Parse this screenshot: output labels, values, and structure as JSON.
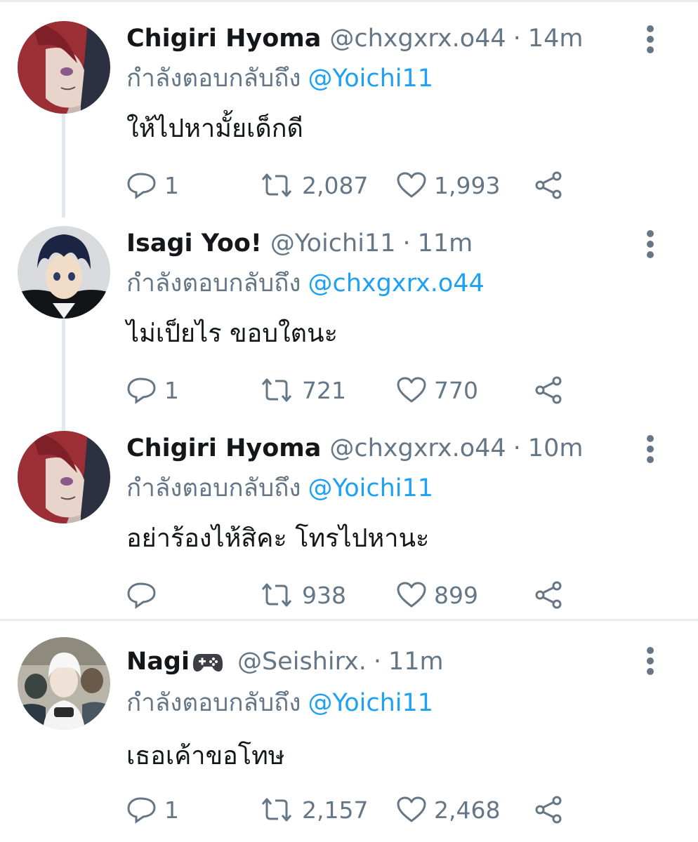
{
  "reply_prefix": "กำลังตอบกลับถึง",
  "colors": {
    "mention": "#1da1f2",
    "meta": "#657786",
    "text": "#14171a"
  },
  "tweets": [
    {
      "name": "Chigiri Hyoma",
      "handle": "@chxgxrx.o44",
      "separator": "·",
      "time": "14m",
      "replying_to": "@Yoichi11",
      "text": "ให้ไปหามั้ยเด็กดี",
      "replies": "1",
      "retweets": "2,087",
      "likes": "1,993",
      "avatar": "red-hair-avatar"
    },
    {
      "name": "Isagi Yoo!",
      "handle": "@Yoichi11",
      "separator": "·",
      "time": "11m",
      "replying_to": "@chxgxrx.o44",
      "text": "ไม่เป็ยไร ขอบใตนะ",
      "replies": "1",
      "retweets": "721",
      "likes": "770",
      "avatar": "dark-hair-avatar"
    },
    {
      "name": "Chigiri Hyoma",
      "handle": "@chxgxrx.o44",
      "separator": "·",
      "time": "10m",
      "replying_to": "@Yoichi11",
      "text": "อย่าร้องไห้สิคะ โทรไปหานะ",
      "replies": "",
      "retweets": "938",
      "likes": "899",
      "avatar": "red-hair-avatar"
    },
    {
      "name": "Nagi",
      "emoji": "game-controller-icon",
      "handle": "@Seishirx.",
      "separator": "·",
      "time": "11m",
      "replying_to": "@Yoichi11",
      "text": "เธอเค้าขอโทษ",
      "replies": "1",
      "retweets": "2,157",
      "likes": "2,468",
      "avatar": "white-hair-avatar"
    }
  ]
}
